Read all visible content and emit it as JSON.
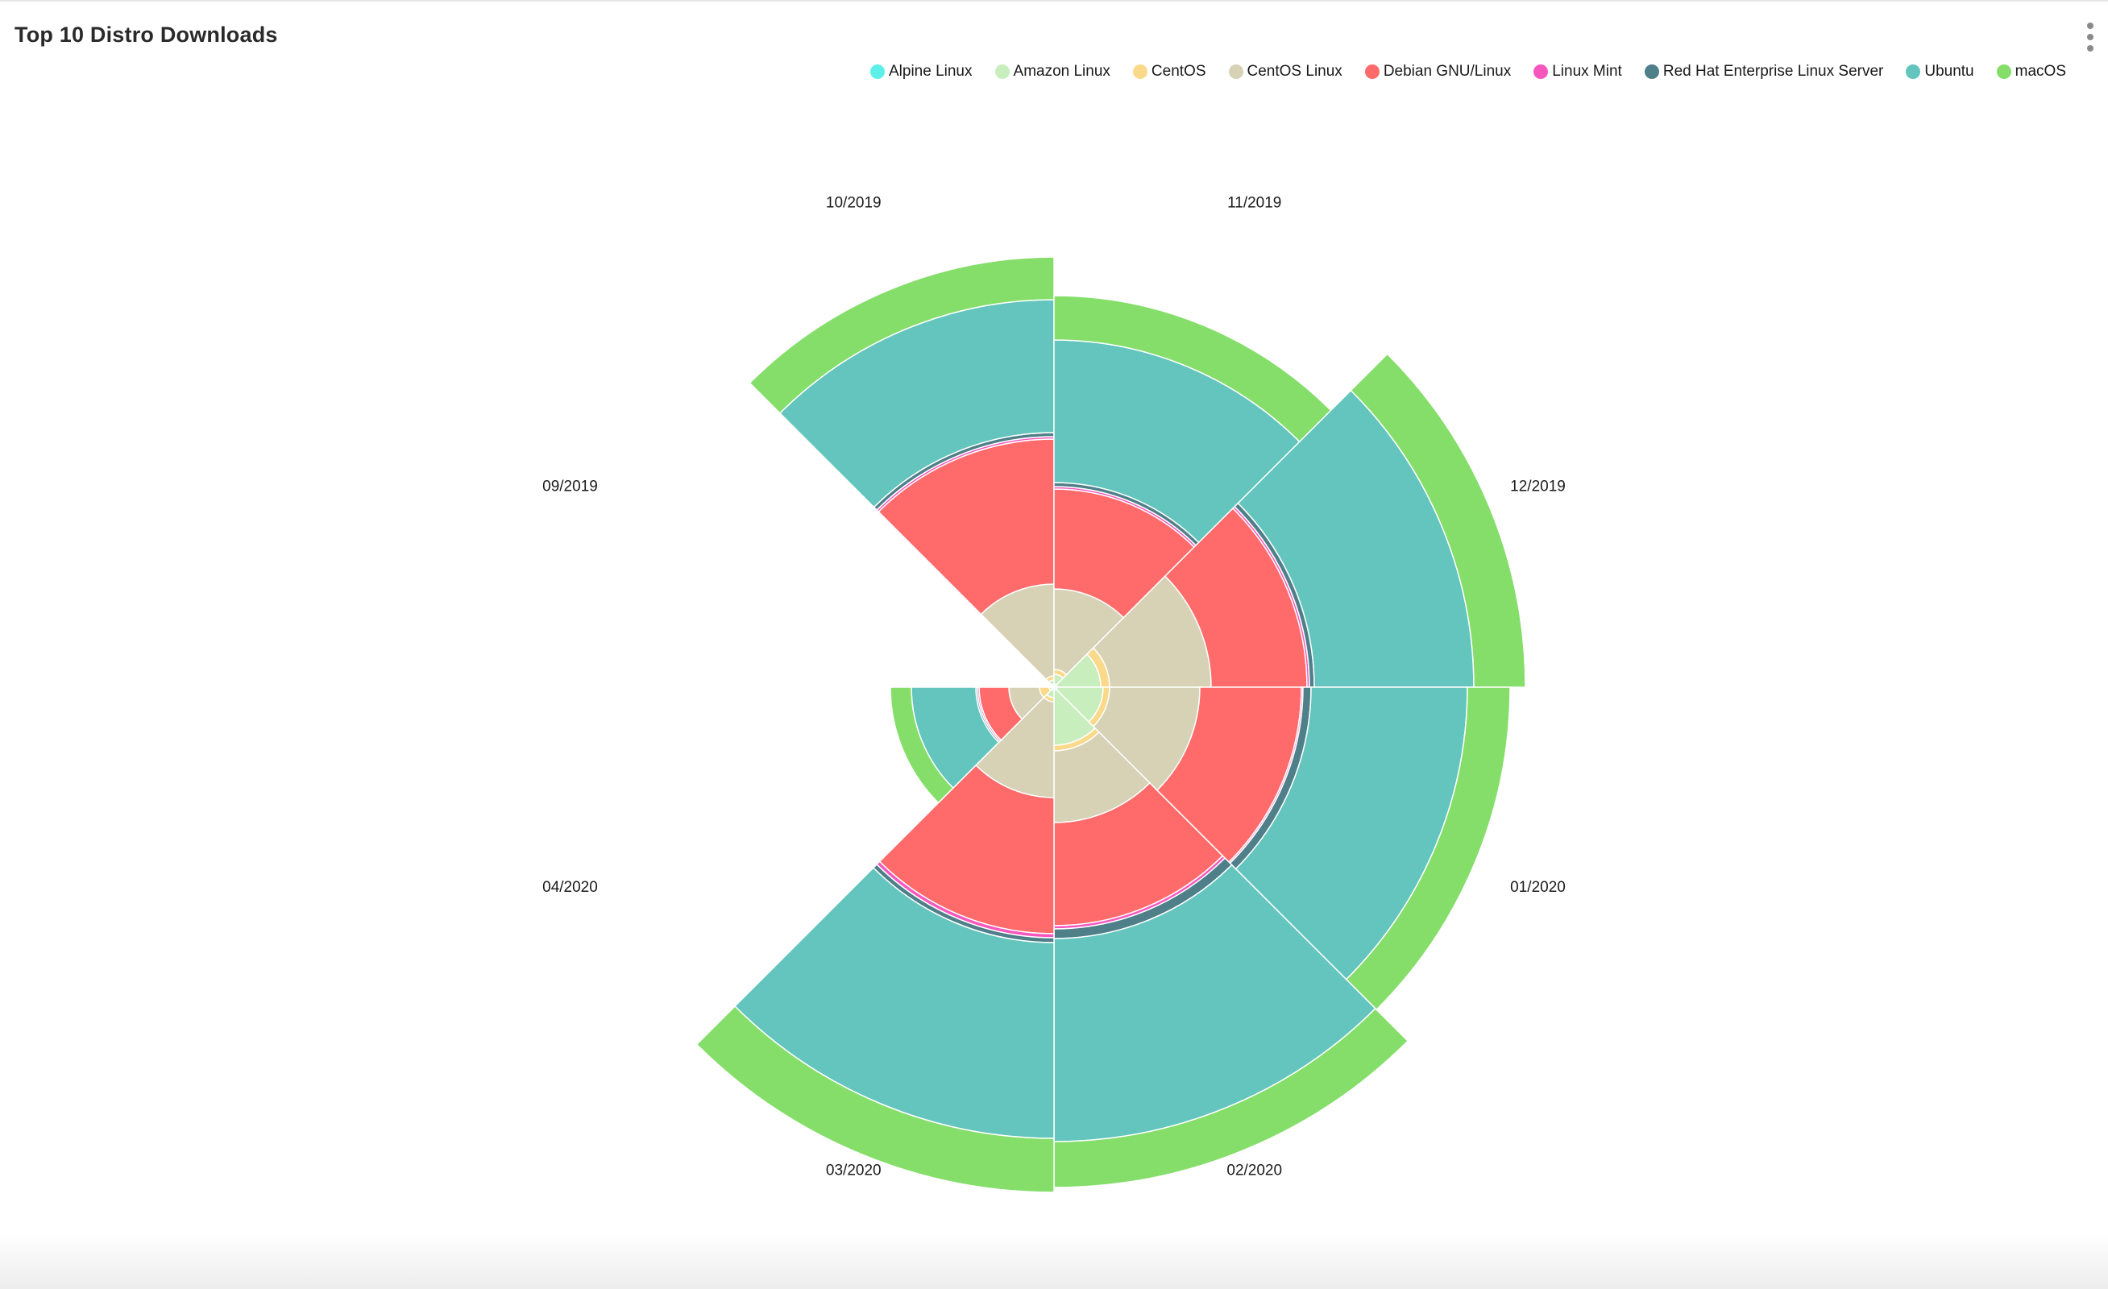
{
  "header": {
    "title": "Top 10 Distro Downloads"
  },
  "toolbar": {
    "menu_icon": "kebab-menu-icon"
  },
  "colors": {
    "Alpine Linux": "#5cf0e8",
    "Amazon Linux": "#c8eebd",
    "CentOS": "#fbd98a",
    "CentOS Linux": "#d7d2b6",
    "Debian GNU/Linux": "#fe6b6a",
    "Linux Mint": "#f657be",
    "Red Hat Enterprise Linux Server": "#4f7f89",
    "Ubuntu": "#63c5bd",
    "macOS": "#85de6a"
  },
  "chart_data": {
    "type": "polar-stacked-bar",
    "title": "Top 10 Distro Downloads",
    "legend_position": "top-right",
    "categories": [
      "09/2019",
      "10/2019",
      "11/2019",
      "12/2019",
      "01/2020",
      "02/2020",
      "03/2020",
      "04/2020"
    ],
    "series": [
      {
        "name": "Alpine Linux",
        "values": [
          0,
          4,
          4,
          4,
          4,
          4,
          4,
          3
        ]
      },
      {
        "name": "Amazon Linux",
        "values": [
          0,
          5,
          12,
          54,
          57,
          68,
          9,
          3
        ]
      },
      {
        "name": "CentOS",
        "values": [
          0,
          5,
          6,
          11,
          8,
          7,
          5,
          12
        ]
      },
      {
        "name": "CentOS Linux",
        "values": [
          0,
          114,
          100,
          126,
          112,
          89,
          119,
          38
        ]
      },
      {
        "name": "Debian GNU/Linux",
        "values": [
          0,
          180,
          124,
          119,
          126,
          128,
          169,
          37
        ]
      },
      {
        "name": "Linux Mint",
        "values": [
          0,
          3,
          3,
          3,
          2,
          4,
          5,
          2
        ]
      },
      {
        "name": "Red Hat Enterprise Linux Server",
        "values": [
          0,
          5,
          5,
          6,
          10,
          12,
          6,
          2
        ]
      },
      {
        "name": "Ubuntu",
        "values": [
          0,
          165,
          177,
          198,
          194,
          252,
          243,
          80
        ]
      },
      {
        "name": "macOS",
        "values": [
          0,
          53,
          55,
          64,
          53,
          57,
          67,
          26
        ]
      }
    ]
  }
}
